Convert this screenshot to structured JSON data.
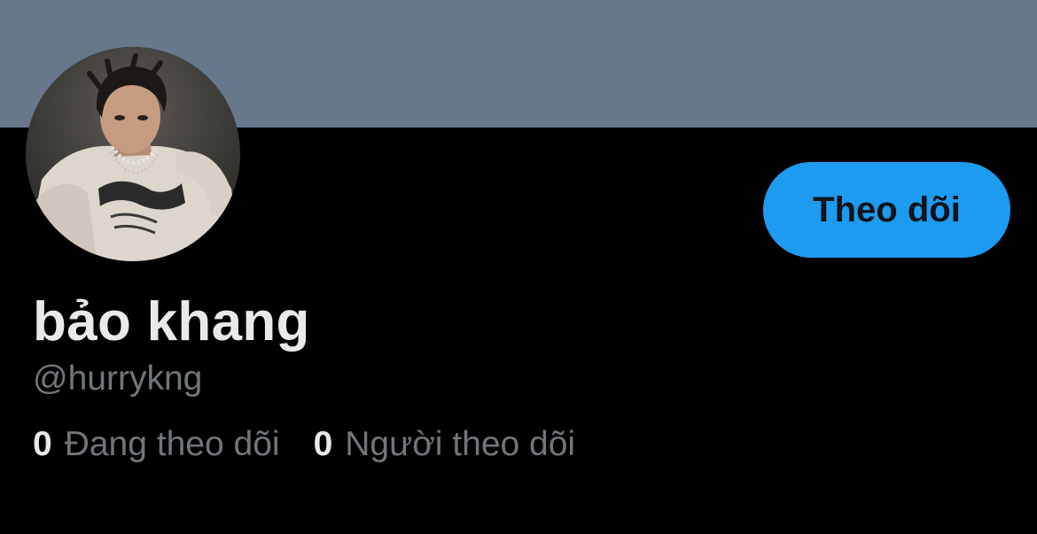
{
  "profile": {
    "display_name": "bảo khang",
    "handle": "@hurrykng",
    "follow_button_label": "Theo dõi",
    "avatar_icon": "profile-photo",
    "stats": {
      "following": {
        "count": "0",
        "label": "Đang theo dõi"
      },
      "followers": {
        "count": "0",
        "label": "Người theo dõi"
      }
    }
  },
  "colors": {
    "banner": "#66788a",
    "background": "#000000",
    "accent": "#1d9bf0",
    "primary_text": "#e7e9ea",
    "secondary_text": "#71767b"
  }
}
